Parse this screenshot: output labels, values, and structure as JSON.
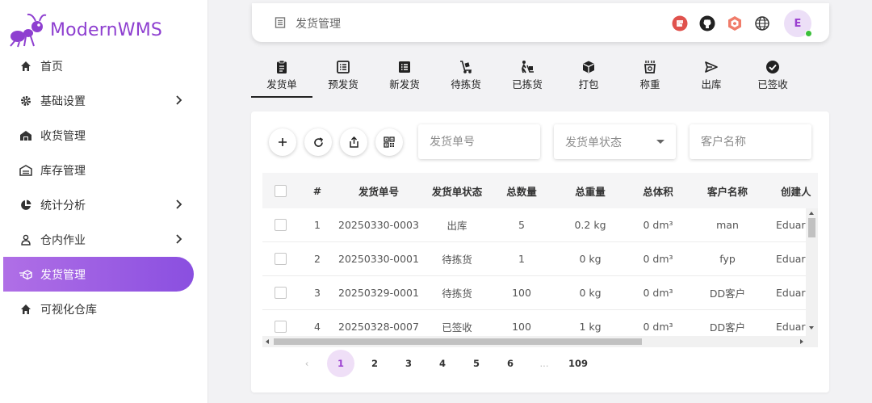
{
  "app": {
    "name": "ModernWMS"
  },
  "sidebar": {
    "items": [
      {
        "label": "首页",
        "icon": "home-icon",
        "expandable": false
      },
      {
        "label": "基础设置",
        "icon": "gear-icon",
        "expandable": true
      },
      {
        "label": "收货管理",
        "icon": "receiving-icon",
        "expandable": false
      },
      {
        "label": "库存管理",
        "icon": "warehouse-icon",
        "expandable": false
      },
      {
        "label": "统计分析",
        "icon": "pie-chart-icon",
        "expandable": true
      },
      {
        "label": "仓内作业",
        "icon": "worker-icon",
        "expandable": true
      },
      {
        "label": "发货管理",
        "icon": "shipping-icon",
        "expandable": false,
        "active": true
      },
      {
        "label": "可视化仓库",
        "icon": "home-icon",
        "expandable": false
      }
    ]
  },
  "topbar": {
    "page_title": "发货管理",
    "avatar_letter": "E",
    "icons": [
      "gitee-icon",
      "github-icon",
      "hexagon-logo-icon",
      "globe-icon"
    ]
  },
  "tabs": [
    {
      "label": "发货单",
      "icon": "clipboard-icon",
      "active": true
    },
    {
      "label": "预发货",
      "icon": "list-icon"
    },
    {
      "label": "新发货",
      "icon": "list-icon"
    },
    {
      "label": "待拣货",
      "icon": "hand-truck-icon"
    },
    {
      "label": "已拣货",
      "icon": "worker-cart-icon"
    },
    {
      "label": "打包",
      "icon": "package-icon"
    },
    {
      "label": "称重",
      "icon": "scale-icon"
    },
    {
      "label": "出库",
      "icon": "send-icon"
    },
    {
      "label": "已签收",
      "icon": "check-circle-icon"
    }
  ],
  "toolbar": {
    "buttons": [
      "add-icon",
      "refresh-icon",
      "export-icon",
      "qrcode-icon"
    ],
    "filters": {
      "dispatch_no_placeholder": "发货单号",
      "status_placeholder": "发货单状态",
      "customer_placeholder": "客户名称"
    }
  },
  "table": {
    "columns": [
      "#",
      "发货单号",
      "发货单状态",
      "总数量",
      "总重量",
      "总体积",
      "客户名称",
      "创建人"
    ],
    "rows": [
      [
        "1",
        "20250330-0003",
        "出库",
        "5",
        "0.2 kg",
        "0 dm³",
        "man",
        "Eduardo"
      ],
      [
        "2",
        "20250330-0001",
        "待拣货",
        "1",
        "0 kg",
        "0 dm³",
        "fyp",
        "Eduardo"
      ],
      [
        "3",
        "20250329-0001",
        "待拣货",
        "100",
        "0 kg",
        "0 dm³",
        "DD客户",
        "Eduardo"
      ],
      [
        "4",
        "20250328-0007",
        "已签收",
        "100",
        "1 kg",
        "0 dm³",
        "DD客户",
        "Eduardo"
      ]
    ]
  },
  "pagination": {
    "prev": "‹",
    "pages": [
      "1",
      "2",
      "3",
      "4",
      "5",
      "6",
      "...",
      "109"
    ],
    "current": "1"
  },
  "colors": {
    "accent": "#8e3fd0",
    "active_gradient_start": "#b06fe6",
    "active_gradient_end": "#8a4fe0"
  }
}
